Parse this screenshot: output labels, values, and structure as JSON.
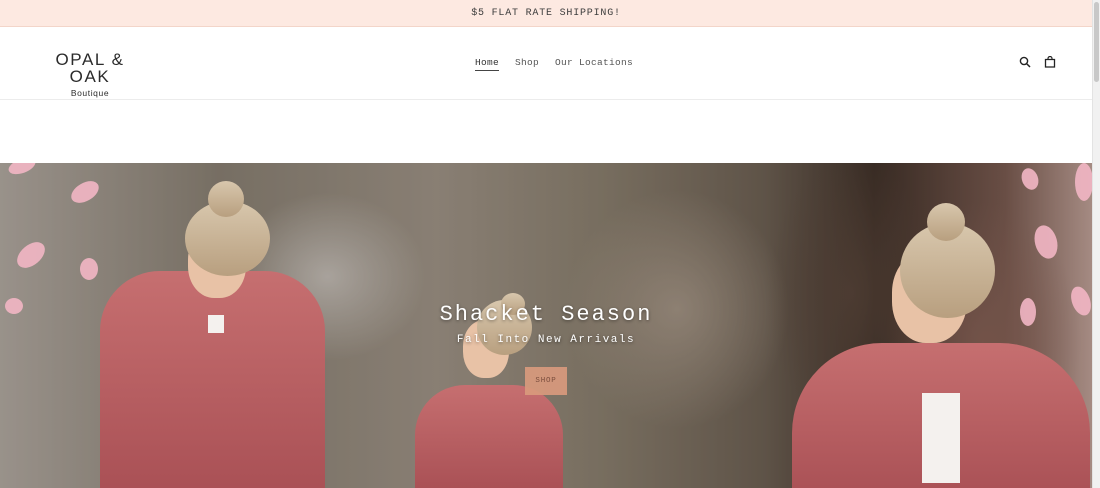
{
  "announcement": {
    "text": "$5 FLAT RATE SHIPPING!"
  },
  "header": {
    "logo_main": "OPAL & OAK",
    "logo_sub": "Boutique",
    "nav": [
      {
        "label": "Home",
        "active": true
      },
      {
        "label": "Shop",
        "active": false
      },
      {
        "label": "Our Locations",
        "active": false
      }
    ],
    "icons": [
      "search-icon",
      "cart-icon"
    ]
  },
  "hero": {
    "title": "Shacket Season",
    "subtitle": "Fall Into New Arrivals",
    "button_label": "SHOP"
  },
  "colors": {
    "announcement_bg": "#fde9e1",
    "button_bg": "#d99a7d",
    "jacket": "#b85c60"
  }
}
